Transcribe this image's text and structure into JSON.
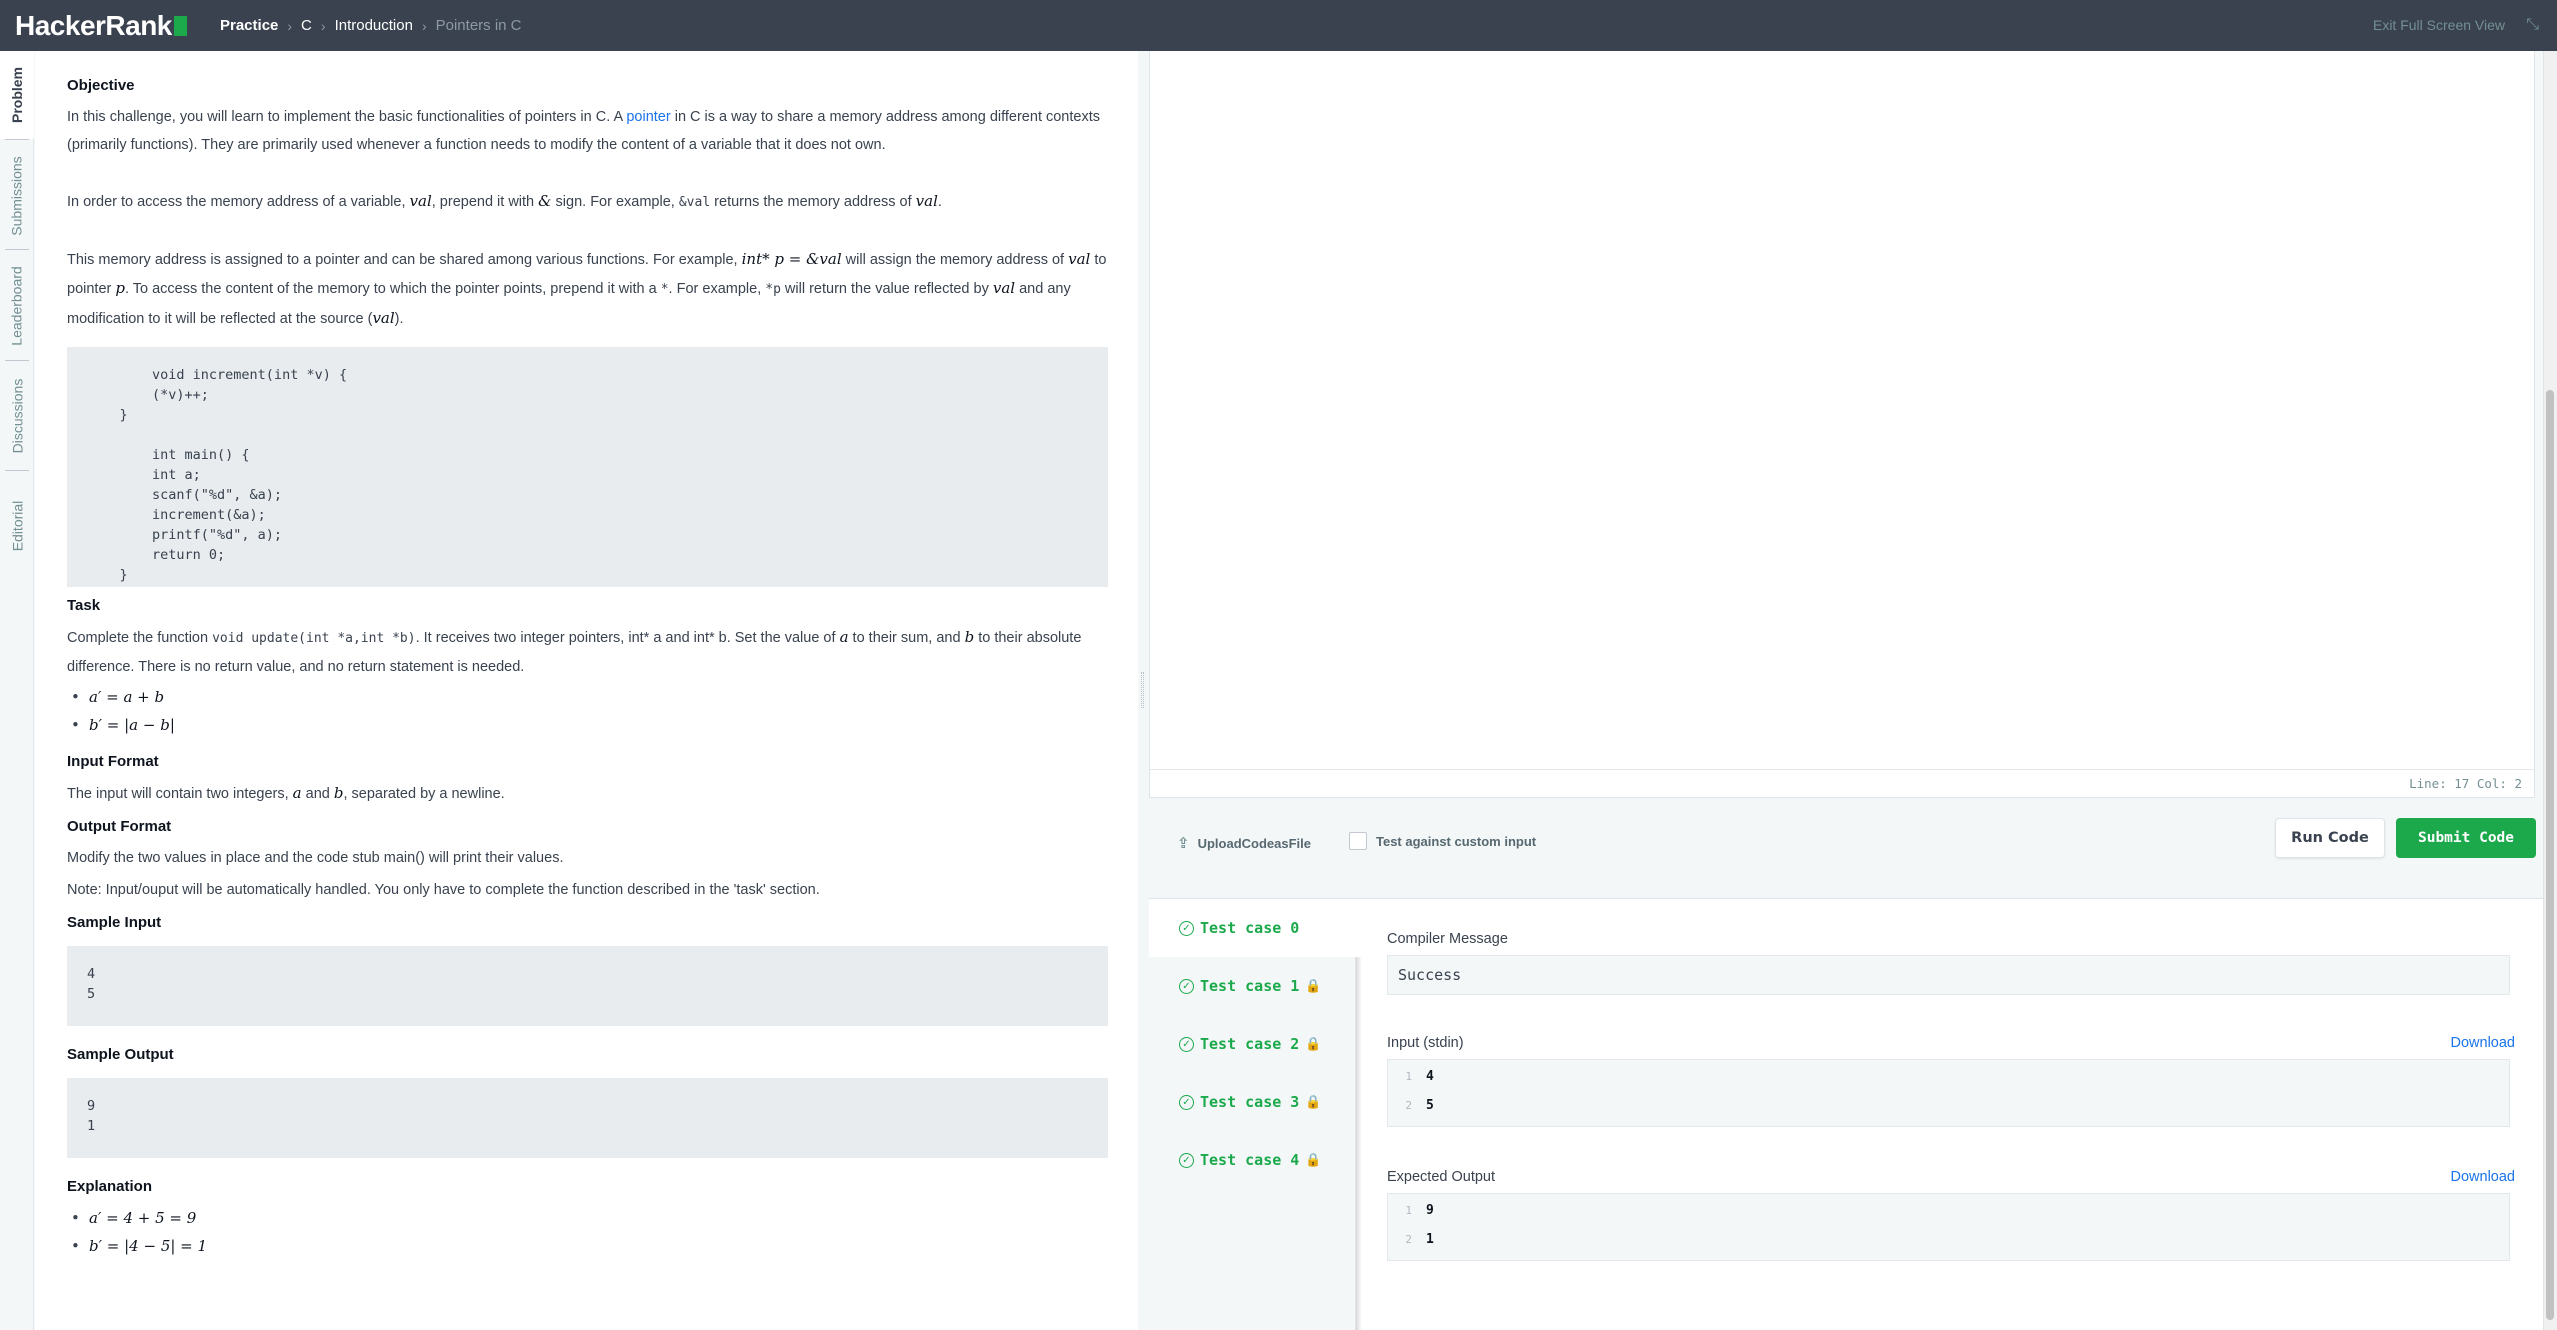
{
  "header": {
    "logo": "HackerRank",
    "breadcrumbs": [
      "Practice",
      "C",
      "Introduction",
      "Pointers in C"
    ],
    "exit_label": "Exit Full Screen View"
  },
  "side_tabs": [
    "Problem",
    "Submissions",
    "Leaderboard",
    "Discussions",
    "Editorial"
  ],
  "problem": {
    "objective_title": "Objective",
    "obj_p1_a": "In this challenge, you will learn to implement the basic functionalities of pointers in C. A ",
    "obj_p1_link": "pointer",
    "obj_p1_b": " in C is a way to share a memory address among different contexts (primarily functions). They are primarily used whenever a function needs to modify the content of a variable that it does not own.",
    "obj_p2_a": "In order to access the memory address of a variable, ",
    "obj_p2_m1": "val",
    "obj_p2_b": ", prepend it with ",
    "obj_p2_amp": "&",
    "obj_p2_c": " sign. For example, ",
    "obj_p2_code": "&val",
    "obj_p2_d": " returns the memory address of ",
    "obj_p2_m2": "val",
    "obj_p2_e": ".",
    "obj_p3_a": "This memory address is assigned to a pointer and can be shared among various functions. For example, ",
    "obj_p3_m1": "int* p = &val",
    "obj_p3_b": " will assign the memory address of ",
    "obj_p3_m2": "val",
    "obj_p3_c": " to pointer ",
    "obj_p3_m3": "p",
    "obj_p3_d": ". To access the content of the memory to which the pointer points, prepend it with a ",
    "obj_p3_code1": "*",
    "obj_p3_e": ". For example, ",
    "obj_p3_code2": "*p",
    "obj_p3_f": " will return the value reflected by ",
    "obj_p3_m4": "val",
    "obj_p3_g": " and any modification to it will be reflected at the source (",
    "obj_p3_m5": "val",
    "obj_p3_h": ").",
    "code_sample": "        void increment(int *v) {\n        (*v)++;\n    }\n\n        int main() {\n        int a;\n        scanf(\"%d\", &a);\n        increment(&a);\n        printf(\"%d\", a);\n        return 0;\n    }",
    "task_title": "Task",
    "task_a": "Complete the function ",
    "task_code": "void update(int *a,int *b)",
    "task_b": ". It receives two integer pointers, int* a and int* b. Set the value of ",
    "task_m1": "a",
    "task_c": " to their sum, and ",
    "task_m2": "b",
    "task_d": " to their absolute difference. There is no return value, and no return statement is needed.",
    "task_bullets": [
      "a′ = a + b",
      "b′ = |a − b|"
    ],
    "input_format_title": "Input Format",
    "input_a": "The input will contain two integers, ",
    "input_m1": "a",
    "input_b": " and ",
    "input_m2": "b",
    "input_c": ", separated by a newline.",
    "output_format_title": "Output Format",
    "output_p1": "Modify the two values in place and the code stub main() will print their values.",
    "output_p2": "Note: Input/ouput will be automatically handled. You only have to complete the function described in the 'task' section.",
    "sample_input_title": "Sample Input",
    "sample_input": "4\n5",
    "sample_output_title": "Sample Output",
    "sample_output": "9\n1",
    "explanation_title": "Explanation",
    "explanation_bullets": [
      "a′ = 4 + 5 = 9",
      "b′ = |4 − 5| = 1"
    ]
  },
  "editor": {
    "status": "Line: 17 Col: 2"
  },
  "actions": {
    "upload_label": "UploadCodeasFile",
    "custom_input_label": "Test against custom input",
    "run_label": "Run Code",
    "submit_label": "Submit Code"
  },
  "results": {
    "test_cases": [
      "Test case 0",
      "Test case 1",
      "Test case 2",
      "Test case 3",
      "Test case 4"
    ],
    "compiler_label": "Compiler Message",
    "compiler_message": "Success",
    "input_label": "Input (stdin)",
    "input_download": "Download",
    "input_lines": [
      {
        "n": "1",
        "v": "4"
      },
      {
        "n": "2",
        "v": "5"
      }
    ],
    "expected_label": "Expected Output",
    "expected_download": "Download",
    "expected_lines": [
      {
        "n": "1",
        "v": "9"
      },
      {
        "n": "2",
        "v": "1"
      }
    ]
  },
  "colors": {
    "accent_green": "#1ba94c",
    "header_bg": "#39424e",
    "link_blue": "#1a73e8"
  }
}
